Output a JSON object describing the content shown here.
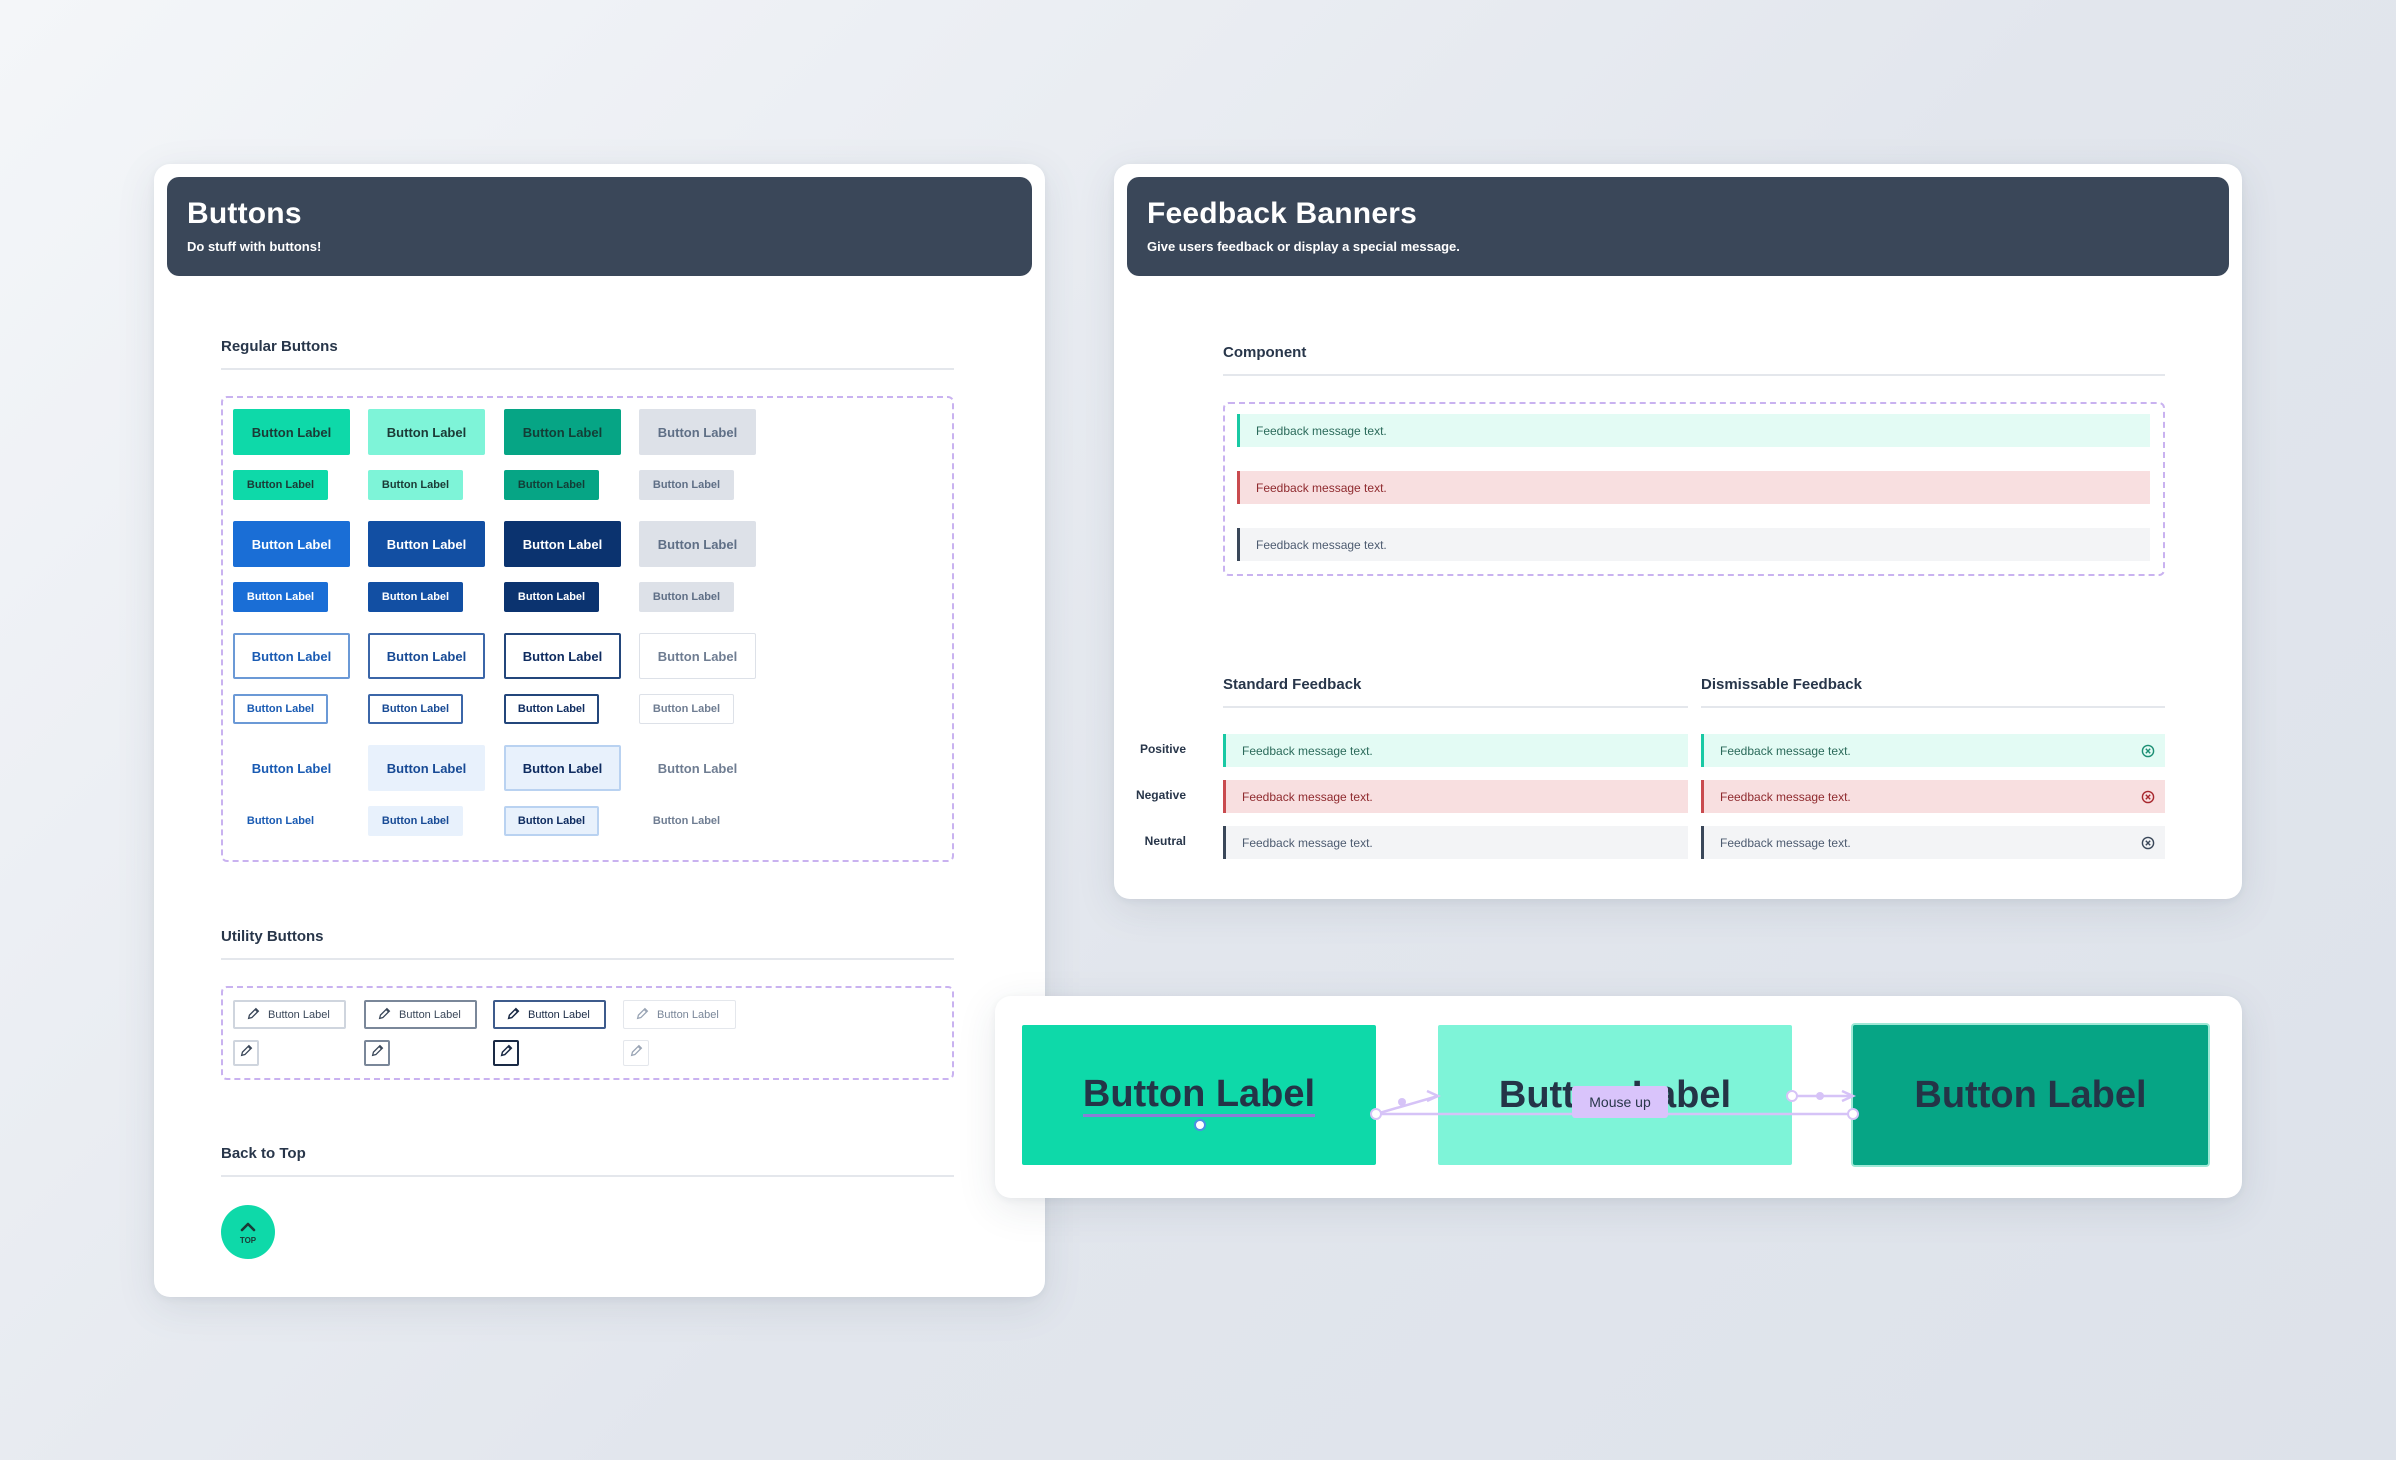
{
  "buttons_card": {
    "title": "Buttons",
    "subtitle": "Do stuff with buttons!",
    "regular_title": "Regular Buttons",
    "utility_title": "Utility Buttons",
    "back_title": "Back to Top",
    "button_label": "Button Label",
    "top_label": "TOP"
  },
  "feedback_card": {
    "title": "Feedback Banners",
    "subtitle": "Give users feedback or display a special message.",
    "component_title": "Component",
    "standard_title": "Standard Feedback",
    "dismissable_title": "Dismissable Feedback",
    "message": "Feedback message text.",
    "rows": {
      "positive": "Positive",
      "negative": "Negative",
      "neutral": "Neutral"
    }
  },
  "interaction_demo": {
    "button_label": "Button Label",
    "mouse_up": "Mouse up"
  },
  "colors": {
    "header": "#3a4759",
    "green_primary": "#0ed9a9",
    "green_light": "#7ef4d8",
    "green_dark": "#06a585",
    "blue_primary": "#1a6ed6",
    "dashed_outline": "#c9b2f0"
  },
  "icons": [
    "pencil-icon",
    "chevron-up-icon",
    "close-circle-icon"
  ]
}
